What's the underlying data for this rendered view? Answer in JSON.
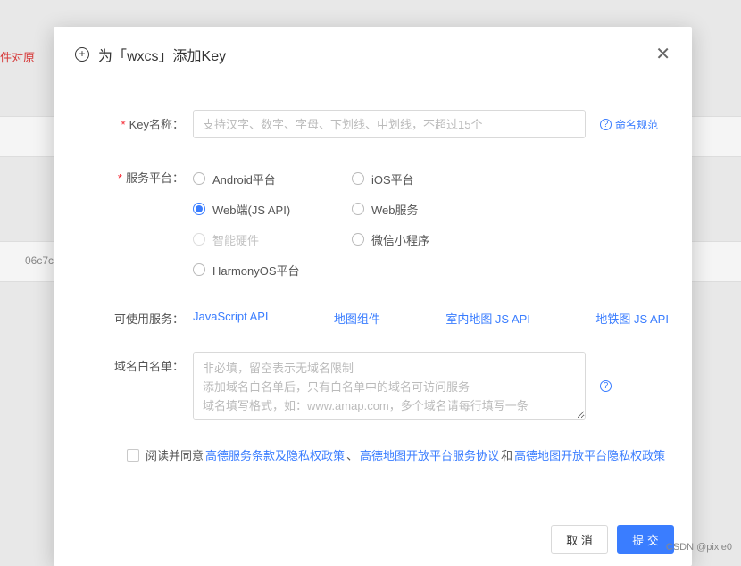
{
  "background": {
    "red_text": "件对原",
    "hash_text": "06c7c"
  },
  "modal": {
    "title": "为「wxcs」添加Key",
    "close": "✕"
  },
  "form": {
    "keyName": {
      "label": "Key名称：",
      "placeholder": "支持汉字、数字、字母、下划线、中划线，不超过15个",
      "help": "命名规范"
    },
    "platform": {
      "label": "服务平台：",
      "options": {
        "android": "Android平台",
        "ios": "iOS平台",
        "webjs": "Web端(JS API)",
        "webservice": "Web服务",
        "hardware": "智能硬件",
        "miniapp": "微信小程序",
        "harmony": "HarmonyOS平台"
      }
    },
    "services": {
      "label": "可使用服务：",
      "links": {
        "jsapi": "JavaScript API",
        "mapcomp": "地图组件",
        "indoor": "室内地图 JS API",
        "subway": "地铁图 JS API"
      }
    },
    "whitelist": {
      "label": "域名白名单：",
      "placeholder": "非必填，留空表示无域名限制\n添加域名白名单后，只有白名单中的域名可访问服务\n域名填写格式，如：www.amap.com，多个域名请每行填写一条"
    },
    "agree": {
      "prefix": "阅读并同意",
      "link1": "高德服务条款及隐私权政策",
      "sep1": "、",
      "link2": "高德地图开放平台服务协议",
      "sep2": " 和 ",
      "link3": "高德地图开放平台隐私权政策"
    }
  },
  "footer": {
    "cancel": "取 消",
    "submit": "提 交"
  },
  "watermark": "CSDN @pixle0"
}
